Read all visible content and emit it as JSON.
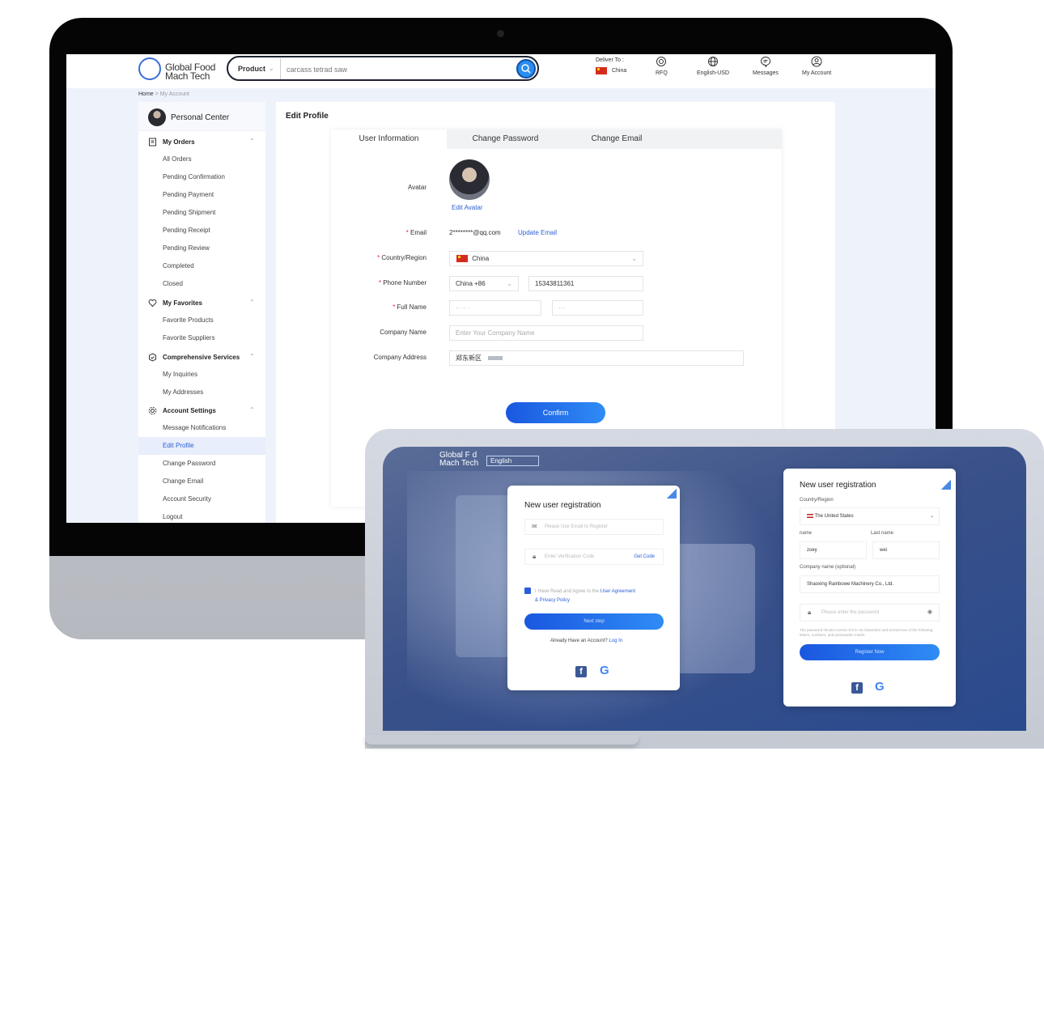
{
  "header": {
    "logo_line1": "Global Food",
    "logo_line2": "Mach Tech",
    "search_category": "Product",
    "search_value": "carcass tetrad saw",
    "deliver_to_label": "Deliver To :",
    "deliver_to_value": "China",
    "rfq": "RFQ",
    "language": "English-USD",
    "messages": "Messages",
    "account": "My Account"
  },
  "breadcrumb": {
    "home": "Home",
    "sep": ">",
    "current": "My Account"
  },
  "sidebar": {
    "title": "Personal Center",
    "groups": [
      {
        "label": "My Orders",
        "items": [
          "All Orders",
          "Pending Confirmation",
          "Pending Payment",
          "Pending Shipment",
          "Pending Receipt",
          "Pending Review",
          "Completed",
          "Closed"
        ]
      },
      {
        "label": "My Favorites",
        "items": [
          "Favorite Products",
          "Favorite Suppliers"
        ]
      },
      {
        "label": "Comprehensive Services",
        "items": [
          "My Inquiries",
          "My Addresses"
        ]
      },
      {
        "label": "Account Settings",
        "items": [
          "Message Notifications",
          "Edit Profile",
          "Change Password",
          "Change Email",
          "Account Security",
          "Logout"
        ]
      }
    ],
    "active_item": "Edit Profile"
  },
  "main": {
    "title": "Edit Profile",
    "tabs": [
      "User Information",
      "Change Password",
      "Change Email"
    ],
    "avatar_label": "Avatar",
    "edit_avatar": "Edit Avatar",
    "email_label": "Email",
    "email_value": "2********@qq.com",
    "update_email": "Update Email",
    "country_label": "Country/Region",
    "country_value": "China",
    "phone_label": "Phone Number",
    "phone_code": "China +86",
    "phone_value": "15343811361",
    "fullname_label": "Full Name",
    "company_label": "Company Name",
    "company_placeholder": "Enter Your Company Name",
    "address_label": "Company Address",
    "address_value": "郑东新区",
    "confirm": "Confirm"
  },
  "laptop": {
    "logo_line1": "Global F    d",
    "logo_line2": "Mach Tech",
    "language": "English",
    "form1": {
      "title": "New user registration",
      "email_placeholder": "Please Use Email to Register",
      "code_placeholder": "Enter Verification Code",
      "get_code": "Get Code",
      "agree_text": "I Have Read and Agree to the",
      "user_agreement": "User Agreement",
      "privacy": "& Privacy Policy",
      "next_step": "Next step",
      "have_account": "Already Have an Account?",
      "login": "Log In"
    },
    "form2": {
      "title": "New user registration",
      "country_label": "Country/Region",
      "country_value": "The United States",
      "name_label": "name",
      "last_name_label": "Last name",
      "first_name": "zoey",
      "last_name": "wei",
      "company_label": "Company name (optional)",
      "company_value": "Shaoxing Rainbowe Machinery Co., Ltd.",
      "password_placeholder": "Please enter the password",
      "password_hint": "The password should consist of 8 to 16 characters and at least two of the following: letters, numbers, and punctuation marks.",
      "register": "Register Now"
    }
  },
  "colors": {
    "accent": "#2b5fd9",
    "button": "#1a57e0",
    "required": "#e23"
  }
}
